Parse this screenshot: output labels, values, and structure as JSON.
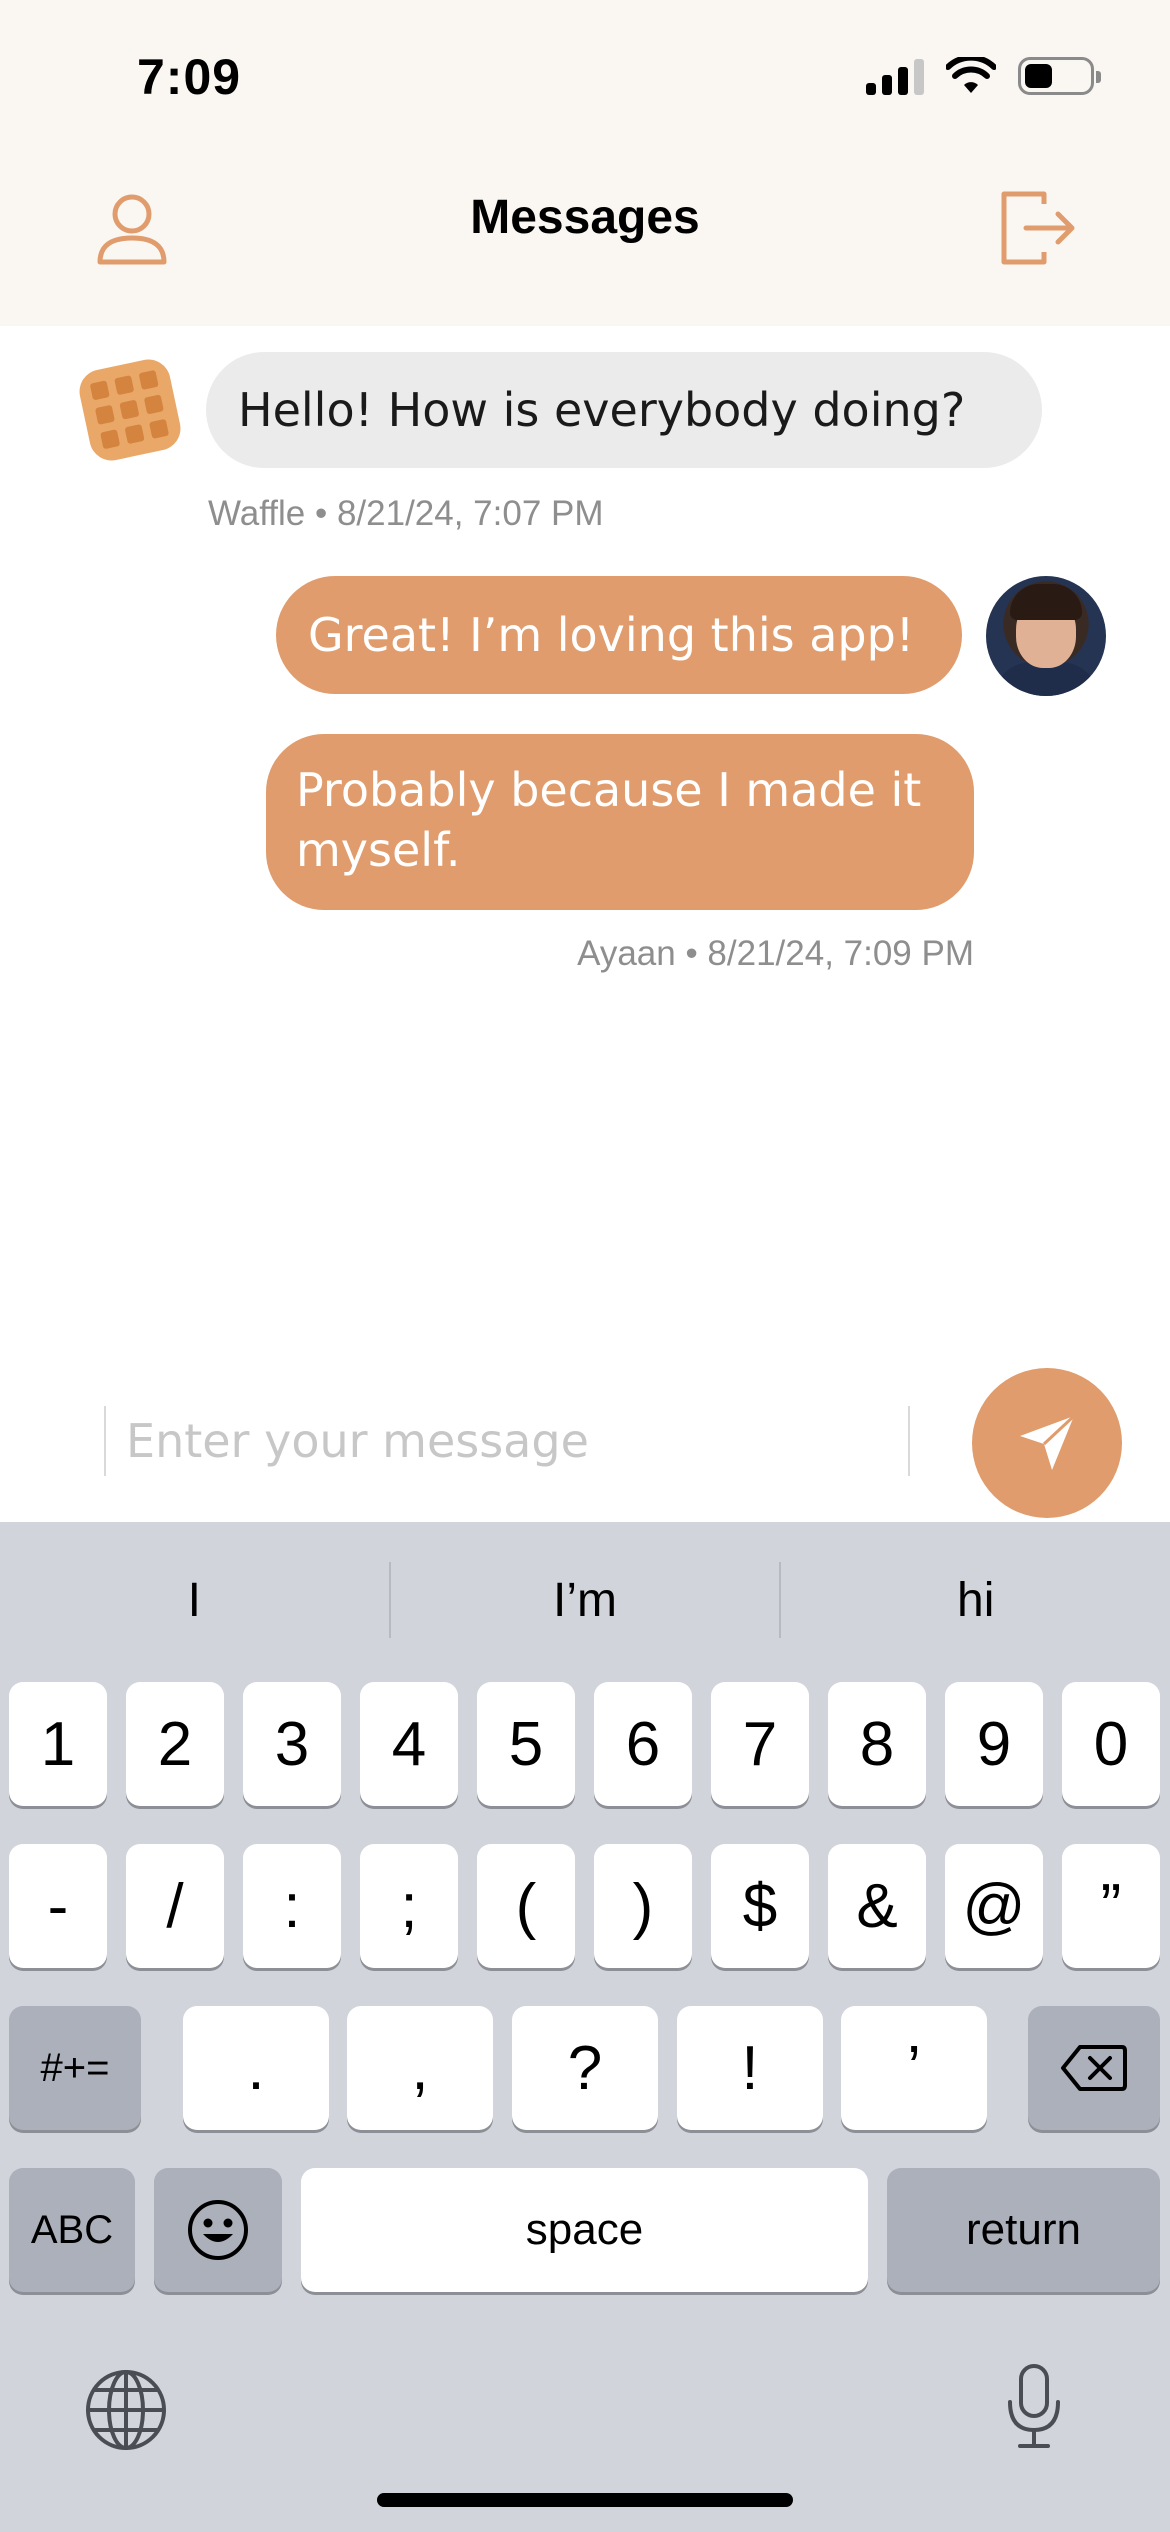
{
  "status_bar": {
    "time": "7:09"
  },
  "header": {
    "title": "Messages",
    "left_icon": "profile-icon",
    "right_icon": "logout-icon"
  },
  "messages": [
    {
      "sender": "Waffle",
      "text": "Hello! How is everybody doing?",
      "direction": "incoming"
    },
    {
      "sender": "Ayaan",
      "text": "Great! I’m loving this app!",
      "direction": "outgoing"
    },
    {
      "sender": "Ayaan",
      "text": "Probably because I made it myself.",
      "direction": "outgoing"
    }
  ],
  "meta": {
    "incoming": "Waffle • 8/21/24, 7:07 PM",
    "outgoing": "Ayaan • 8/21/24, 7:09 PM"
  },
  "composer": {
    "placeholder": "Enter your message",
    "value": "",
    "send_icon": "send-icon"
  },
  "keyboard": {
    "suggestions": [
      "I",
      "I’m",
      "hi"
    ],
    "row1": [
      "1",
      "2",
      "3",
      "4",
      "5",
      "6",
      "7",
      "8",
      "9",
      "0"
    ],
    "row2": [
      "-",
      "/",
      ":",
      ";",
      "(",
      ")",
      "$",
      "&",
      "@",
      "”"
    ],
    "row3": [
      ".",
      ",",
      "?",
      "!",
      "’"
    ],
    "symbols_key": "#+=",
    "abc_key": "ABC",
    "space_key": "space",
    "return_key": "return"
  },
  "colors": {
    "accent": "#e09c6c",
    "header_bg": "#faf6f2",
    "keyboard_bg": "#d1d4db"
  }
}
